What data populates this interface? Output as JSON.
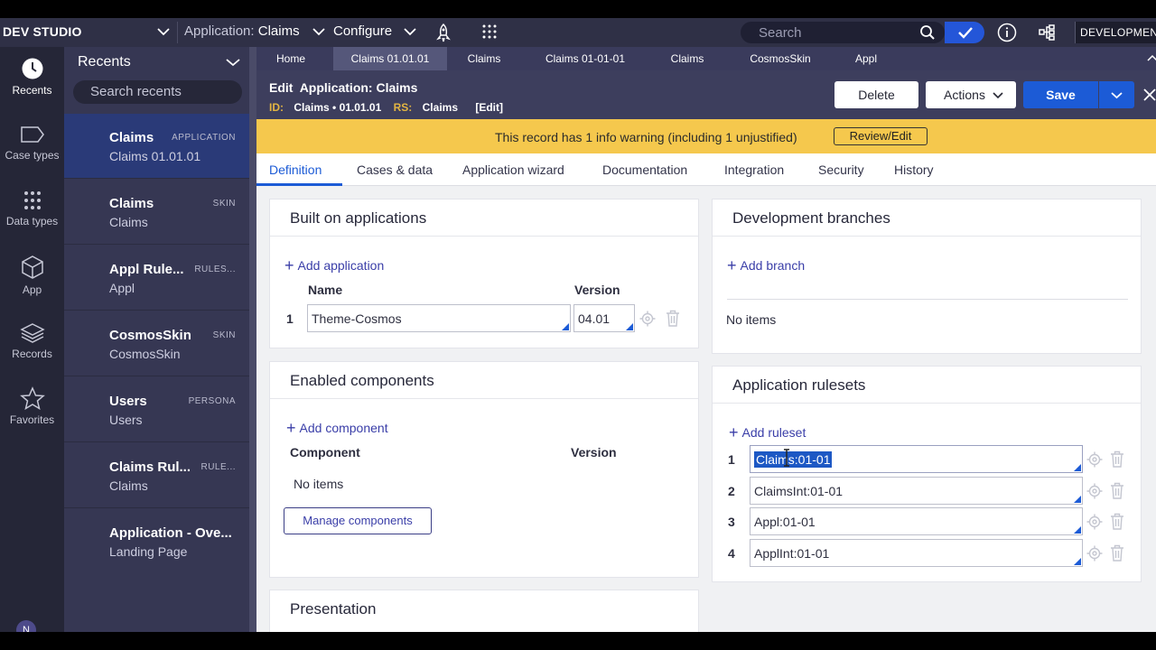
{
  "topbar": {
    "brand": "DEV STUDIO",
    "app_prefix": "Application:",
    "app_name": "Claims",
    "configure": "Configure",
    "search_placeholder": "Search",
    "environment": "DEVELOPMENT"
  },
  "leftnav": {
    "items": [
      {
        "label": "Recents",
        "icon": "clock-icon"
      },
      {
        "label": "Case types",
        "icon": "case-type-icon"
      },
      {
        "label": "Data types",
        "icon": "grid-dots-icon"
      },
      {
        "label": "App",
        "icon": "cube-icon"
      },
      {
        "label": "Records",
        "icon": "layers-icon"
      },
      {
        "label": "Favorites",
        "icon": "star-icon"
      }
    ],
    "avatar": "N"
  },
  "recents": {
    "title": "Recents",
    "search_placeholder": "Search recents",
    "items": [
      {
        "name": "Claims",
        "tag": "APPLICATION",
        "sub": "Claims 01.01.01"
      },
      {
        "name": "Claims",
        "tag": "SKIN",
        "sub": "Claims"
      },
      {
        "name": "Appl Rule...",
        "tag": "RULES...",
        "sub": "Appl"
      },
      {
        "name": "CosmosSkin",
        "tag": "SKIN",
        "sub": "CosmosSkin"
      },
      {
        "name": "Users",
        "tag": "PERSONA",
        "sub": "Users"
      },
      {
        "name": "Claims Rul...",
        "tag": "RULE...",
        "sub": "Claims"
      },
      {
        "name": "Application - Ove...",
        "tag": "",
        "sub": "Landing Page"
      }
    ]
  },
  "tabs": [
    "Home",
    "Claims 01.01.01",
    "Claims",
    "Claims 01-01-01",
    "Claims",
    "CosmosSkin",
    "Appl"
  ],
  "header": {
    "title": "Edit  Application: Claims",
    "id_label": "ID:",
    "id_value": "Claims • 01.01.01",
    "rs_label": "RS:",
    "rs_value": "Claims",
    "edit_link": "[Edit]",
    "delete": "Delete",
    "actions": "Actions",
    "save": "Save"
  },
  "warning": {
    "text": "This record has 1 info warning (including 1 unjustified)",
    "button": "Review/Edit"
  },
  "subtabs": [
    "Definition",
    "Cases & data",
    "Application wizard",
    "Documentation",
    "Integration",
    "Security",
    "History"
  ],
  "built_on": {
    "title": "Built on applications",
    "add": "Add application",
    "col_name": "Name",
    "col_version": "Version",
    "rows": [
      {
        "num": "1",
        "name": "Theme-Cosmos",
        "version": "04.01"
      }
    ]
  },
  "components": {
    "title": "Enabled components",
    "add": "Add component",
    "col_component": "Component",
    "col_version": "Version",
    "empty": "No items",
    "manage": "Manage components"
  },
  "presentation": {
    "title": "Presentation"
  },
  "branches": {
    "title": "Development branches",
    "add": "Add branch",
    "empty": "No items"
  },
  "rulesets": {
    "title": "Application rulesets",
    "add": "Add ruleset",
    "rows": [
      {
        "num": "1",
        "value": "Claims:01-01"
      },
      {
        "num": "2",
        "value": "ClaimsInt:01-01"
      },
      {
        "num": "3",
        "value": "Appl:01-01"
      },
      {
        "num": "4",
        "value": "ApplInt:01-01"
      }
    ]
  },
  "colors": {
    "accent": "#1c5bd6",
    "warning": "#f5c84d",
    "nav": "#252637"
  }
}
